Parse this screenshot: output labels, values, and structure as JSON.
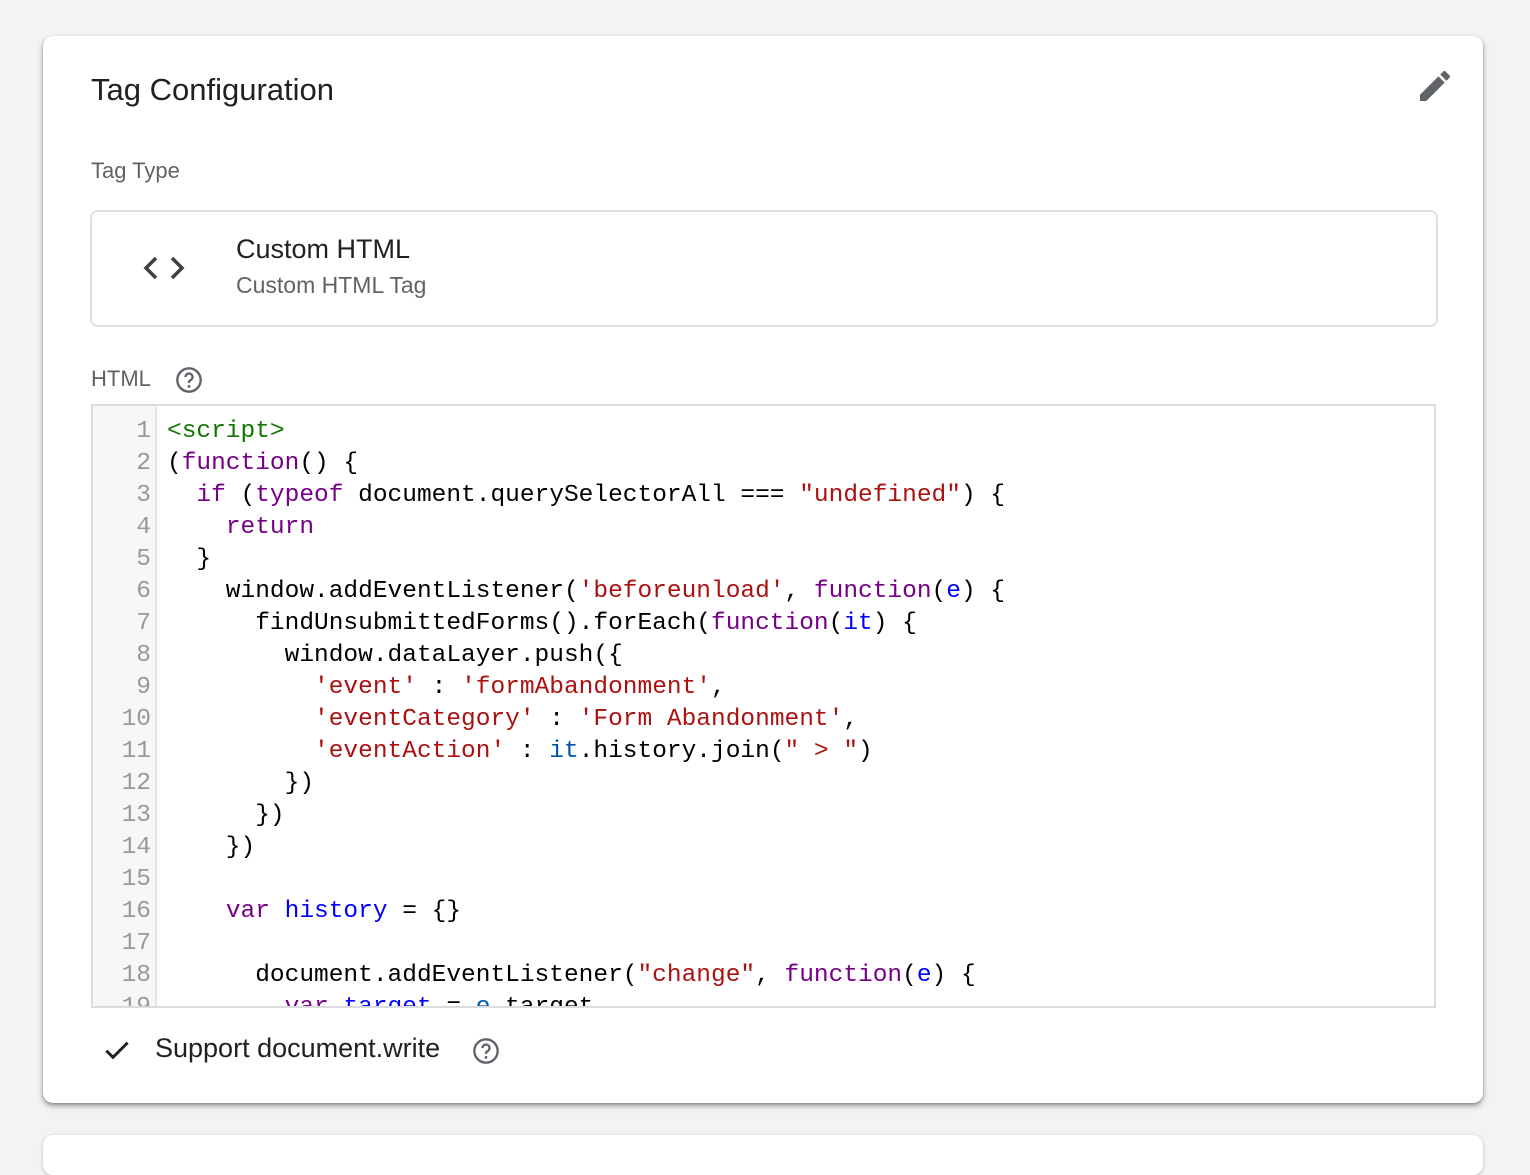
{
  "card": {
    "title": "Tag Configuration",
    "edit_icon": "pencil-icon",
    "tag_type_label": "Tag Type",
    "tag_type": {
      "icon": "code-brackets-icon",
      "name": "Custom HTML",
      "subtitle": "Custom HTML Tag"
    },
    "html_label": "HTML",
    "help_icon": "help-circle-icon",
    "support_document_write": {
      "label": "Support document.write",
      "checked": true,
      "icon": "checkmark-icon"
    }
  },
  "colors": {
    "keyword": "#770088",
    "string": "#aa1111",
    "def": "#0000ff",
    "tag": "#117700",
    "variable2": "#0055aa",
    "gutter_text": "#999999"
  },
  "code_lines": [
    [
      [
        "<script>",
        "tag"
      ]
    ],
    [
      [
        "(",
        ""
      ],
      [
        "function",
        "kw"
      ],
      [
        "() {",
        ""
      ]
    ],
    [
      [
        "  ",
        ""
      ],
      [
        "if",
        "kw"
      ],
      [
        " (",
        ""
      ],
      [
        "typeof",
        "kw"
      ],
      [
        " document.querySelectorAll === ",
        ""
      ],
      [
        "\"undefined\"",
        "str"
      ],
      [
        ") {",
        ""
      ]
    ],
    [
      [
        "    ",
        ""
      ],
      [
        "return",
        "kw"
      ]
    ],
    [
      [
        "  }",
        ""
      ]
    ],
    [
      [
        "    window.addEventListener(",
        ""
      ],
      [
        "'beforeunload'",
        "str"
      ],
      [
        ", ",
        ""
      ],
      [
        "function",
        "kw"
      ],
      [
        "(",
        ""
      ],
      [
        "e",
        "def"
      ],
      [
        ") {",
        ""
      ]
    ],
    [
      [
        "      findUnsubmittedForms().forEach(",
        ""
      ],
      [
        "function",
        "kw"
      ],
      [
        "(",
        ""
      ],
      [
        "it",
        "def"
      ],
      [
        ") {",
        ""
      ]
    ],
    [
      [
        "        window.dataLayer.push({",
        ""
      ]
    ],
    [
      [
        "          ",
        ""
      ],
      [
        "'event'",
        "str"
      ],
      [
        " : ",
        ""
      ],
      [
        "'formAbandonment'",
        "str"
      ],
      [
        ",",
        ""
      ]
    ],
    [
      [
        "          ",
        ""
      ],
      [
        "'eventCategory'",
        "str"
      ],
      [
        " : ",
        ""
      ],
      [
        "'Form Abandonment'",
        "str"
      ],
      [
        ",",
        ""
      ]
    ],
    [
      [
        "          ",
        ""
      ],
      [
        "'eventAction'",
        "str"
      ],
      [
        " : ",
        ""
      ],
      [
        "it",
        "v2"
      ],
      [
        ".history.join(",
        ""
      ],
      [
        "\" > \"",
        "str"
      ],
      [
        ")",
        ""
      ]
    ],
    [
      [
        "        })",
        ""
      ]
    ],
    [
      [
        "      })",
        ""
      ]
    ],
    [
      [
        "    })",
        ""
      ]
    ],
    [
      [
        "",
        ""
      ]
    ],
    [
      [
        "    ",
        ""
      ],
      [
        "var",
        "kw"
      ],
      [
        " ",
        ""
      ],
      [
        "history",
        "def"
      ],
      [
        " = {}",
        ""
      ]
    ],
    [
      [
        "",
        ""
      ]
    ],
    [
      [
        "      document.addEventListener(",
        ""
      ],
      [
        "\"change\"",
        "str"
      ],
      [
        ", ",
        ""
      ],
      [
        "function",
        "kw"
      ],
      [
        "(",
        ""
      ],
      [
        "e",
        "def"
      ],
      [
        ") {",
        ""
      ]
    ],
    [
      [
        "        ",
        ""
      ],
      [
        "var",
        "kw"
      ],
      [
        " ",
        ""
      ],
      [
        "target",
        "def"
      ],
      [
        " = ",
        ""
      ],
      [
        "e",
        "v2"
      ],
      [
        ".target",
        ""
      ]
    ]
  ]
}
